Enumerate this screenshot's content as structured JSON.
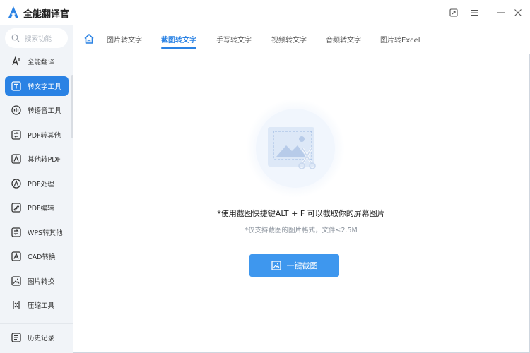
{
  "app": {
    "title": "全能翻译官"
  },
  "window_controls": [
    "restore-icon",
    "menu-icon",
    "minimize-icon",
    "close-icon"
  ],
  "search": {
    "placeholder": "搜索功能"
  },
  "sidebar": {
    "items": [
      {
        "label": "全能翻译",
        "icon": "translate-icon",
        "active": false
      },
      {
        "label": "转文字工具",
        "icon": "text-tool-icon",
        "active": true
      },
      {
        "label": "转语音工具",
        "icon": "audio-wave-icon",
        "active": false
      },
      {
        "label": "PDF转其他",
        "icon": "pdf-convert-icon",
        "active": false
      },
      {
        "label": "其他转PDF",
        "icon": "to-pdf-icon",
        "active": false
      },
      {
        "label": "PDF处理",
        "icon": "pdf-process-icon",
        "active": false
      },
      {
        "label": "PDF编辑",
        "icon": "pdf-edit-icon",
        "active": false
      },
      {
        "label": "WPS转其他",
        "icon": "wps-icon",
        "active": false
      },
      {
        "label": "CAD转换",
        "icon": "cad-icon",
        "active": false
      },
      {
        "label": "图片转换",
        "icon": "image-convert-icon",
        "active": false
      },
      {
        "label": "压缩工具",
        "icon": "compress-icon",
        "active": false
      }
    ],
    "history": {
      "label": "历史记录",
      "icon": "history-icon"
    }
  },
  "tabs": [
    {
      "label": "图片转文字",
      "active": false
    },
    {
      "label": "截图转文字",
      "active": true
    },
    {
      "label": "手写转文字",
      "active": false
    },
    {
      "label": "视频转文字",
      "active": false
    },
    {
      "label": "音频转文字",
      "active": false
    },
    {
      "label": "图片转Excel",
      "active": false
    }
  ],
  "main": {
    "instruction": "*使用截图快捷键ALT + F 可以截取你的屏幕图片",
    "hint": "*仅支持截图的图片格式，文件≤2.5M",
    "button_label": "一键截图"
  },
  "colors": {
    "accent": "#2a82e4",
    "button": "#3e97ee",
    "sidebar_bg": "#f1f4f8"
  }
}
